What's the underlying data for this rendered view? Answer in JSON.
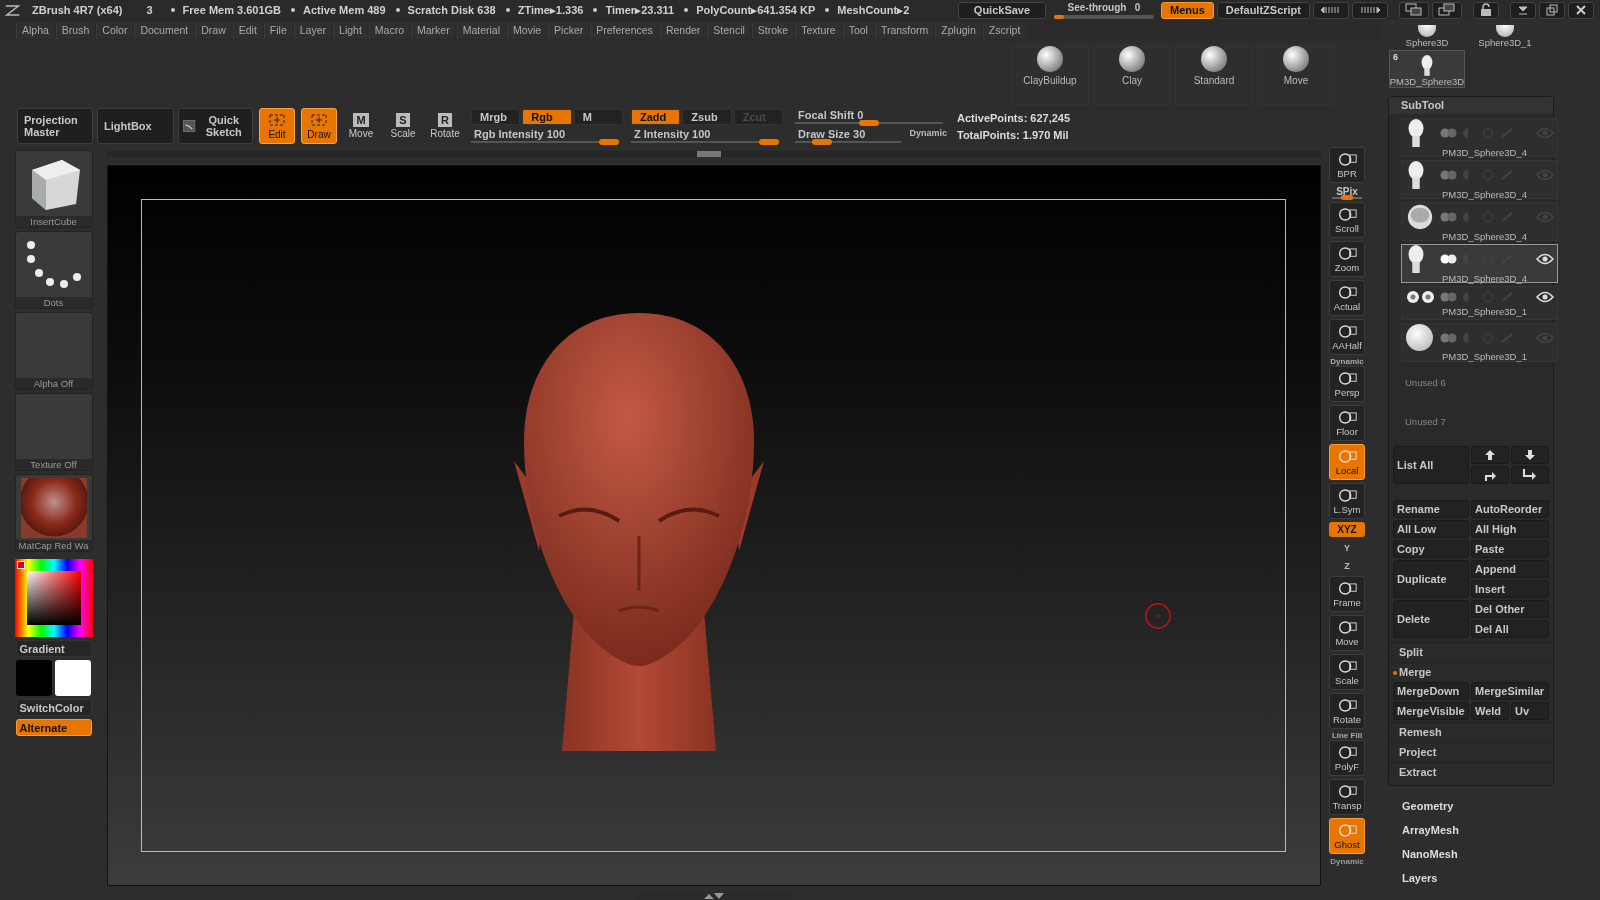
{
  "title_bar": {
    "app": "ZBrush 4R7 (x64)",
    "number": "3",
    "stats": [
      "Free Mem 3.601GB",
      "Active Mem 489",
      "Scratch Disk 638",
      "ZTime▸1.336",
      "Timer▸23.311",
      "PolyCount▸641.354 KP",
      "MeshCount▸2"
    ],
    "quicksave": "QuickSave",
    "see_through": {
      "label": "See-through",
      "value": "0",
      "level": 0.05
    },
    "menus": {
      "label": "Menus",
      "selected": true
    },
    "script": "DefaultZScript"
  },
  "menu": [
    "Alpha",
    "Brush",
    "Color",
    "Document",
    "Draw",
    "Edit",
    "File",
    "Layer",
    "Light",
    "Macro",
    "Marker",
    "Material",
    "Movie",
    "Picker",
    "Preferences",
    "Render",
    "Stencil",
    "Stroke",
    "Texture",
    "Tool",
    "Transform",
    "Zplugin",
    "Zscript"
  ],
  "shelf": {
    "brushes": [
      "ClayBuildup",
      "Clay",
      "Standard",
      "Move"
    ]
  },
  "toolbar": {
    "projection_master": "Projection Master",
    "lightbox": "LightBox",
    "quick_sketch": "Quick Sketch",
    "modes": [
      {
        "label": "Edit",
        "selected": true
      },
      {
        "label": "Draw",
        "selected": true
      },
      {
        "label": "Move",
        "glyph": "M",
        "selected": false
      },
      {
        "label": "Scale",
        "glyph": "S",
        "selected": false
      },
      {
        "label": "Rotate",
        "glyph": "R",
        "selected": false
      }
    ],
    "channels": [
      {
        "label": "Mrgb",
        "selected": false,
        "disabled": false
      },
      {
        "label": "Rgb",
        "selected": true,
        "disabled": false
      },
      {
        "label": "M",
        "selected": false,
        "disabled": false
      }
    ],
    "depth": [
      {
        "label": "Zadd",
        "selected": true,
        "disabled": false
      },
      {
        "label": "Zsub",
        "selected": false,
        "disabled": false
      },
      {
        "label": "Zcut",
        "selected": false,
        "disabled": true
      }
    ],
    "rgb_intensity": {
      "label": "Rgb  Intensity",
      "value": "100",
      "level": 1
    },
    "z_intensity": {
      "label": "Z  Intensity",
      "value": "100",
      "level": 1
    },
    "focal_shift": {
      "label": "Focal  Shift",
      "value": "0",
      "level": 0.5
    },
    "draw_size": {
      "label": "Draw  Size",
      "value": "30",
      "level": 0.2,
      "dynamic": "Dynamic"
    },
    "points": [
      "ActivePoints: 627,245",
      "TotalPoints: 1.970  Mil"
    ]
  },
  "left_panel": {
    "thumbnails": [
      {
        "label": "InsertCube",
        "kind": "cube"
      },
      {
        "label": "Dots",
        "kind": "dots"
      },
      {
        "label": "Alpha  Off",
        "kind": "empty"
      },
      {
        "label": "Texture  Off",
        "kind": "empty"
      },
      {
        "label": "MatCap  Red  Wa",
        "kind": "sphere"
      }
    ],
    "gradient": "Gradient",
    "switch_color": "SwitchColor",
    "alternate": {
      "label": "Alternate",
      "on": true
    }
  },
  "right_tools": [
    {
      "label": "BPR",
      "kind": "tall",
      "on": false
    },
    {
      "label": "SPix",
      "kind": "slider",
      "level": 0.5
    },
    {
      "label": "Scroll",
      "kind": "tall",
      "on": false
    },
    {
      "label": "Zoom",
      "kind": "tall",
      "on": false
    },
    {
      "label": "Actual",
      "kind": "tall",
      "on": false
    },
    {
      "label": "AAHalf",
      "kind": "tall",
      "on": false
    },
    {
      "label": "Persp",
      "kind": "tall",
      "on": false,
      "caption": "Dynamic"
    },
    {
      "label": "Floor",
      "kind": "tall",
      "on": false
    },
    {
      "label": "Local",
      "kind": "tall",
      "on": true
    },
    {
      "label": "L.Sym",
      "kind": "tall",
      "on": false
    },
    {
      "label": "XYZ",
      "kind": "pill",
      "on": true
    },
    {
      "label": "Y",
      "kind": "rot"
    },
    {
      "label": "Z",
      "kind": "rot"
    },
    {
      "label": "Frame",
      "kind": "tall",
      "on": false
    },
    {
      "label": "Move",
      "kind": "tall",
      "on": false
    },
    {
      "label": "Scale",
      "kind": "tall",
      "on": false
    },
    {
      "label": "Rotate",
      "kind": "tall",
      "on": false
    },
    {
      "label": "PolyF",
      "kind": "tall",
      "on": false,
      "caption": "Line Fill"
    },
    {
      "label": "Transp",
      "kind": "tall",
      "on": false
    },
    {
      "label": "Ghost",
      "kind": "tall",
      "on": true
    },
    {
      "label": "Dynamic",
      "kind": "partial"
    }
  ],
  "right_panel": {
    "tools": [
      {
        "label": "Sphere3D",
        "kind": "sphere"
      },
      {
        "label": "Sphere3D_1",
        "kind": "sphere"
      },
      {
        "label": "PM3D_Sphere3D",
        "kind": "bust",
        "badge": "6"
      }
    ],
    "subtool": {
      "title": "SubTool",
      "items": [
        {
          "name": "PM3D_Sphere3D_4",
          "kind": "bust",
          "selected": false,
          "visible": false
        },
        {
          "name": "PM3D_Sphere3D_4",
          "kind": "bust",
          "selected": false,
          "visible": false
        },
        {
          "name": "PM3D_Sphere3D_4",
          "kind": "bowl",
          "selected": false,
          "visible": false
        },
        {
          "name": "PM3D_Sphere3D_4",
          "kind": "bust",
          "selected": true,
          "visible": true
        },
        {
          "name": "PM3D_Sphere3D_1",
          "kind": "eyes",
          "selected": false,
          "visible": true
        },
        {
          "name": "PM3D_Sphere3D_1",
          "kind": "sphere",
          "selected": false,
          "visible": false
        }
      ],
      "unused": [
        "Unused  6",
        "Unused  7"
      ],
      "list_all": "List  All",
      "button_columns": [
        [
          {
            "label": "Rename",
            "kind": "short"
          },
          {
            "label": "All  Low",
            "kind": "short"
          },
          {
            "label": "Copy",
            "kind": "short"
          },
          {
            "label": "Duplicate",
            "kind": "tall"
          },
          {
            "label": "Delete",
            "kind": "tall"
          }
        ],
        [
          {
            "label": "AutoReorder",
            "kind": "short"
          },
          {
            "label": "All  High",
            "kind": "short"
          },
          {
            "label": "Paste",
            "kind": "short"
          },
          {
            "label": "Append",
            "kind": "short"
          },
          {
            "label": "Insert",
            "kind": "short"
          },
          {
            "label": "Del  Other",
            "kind": "short"
          },
          {
            "label": "Del  All",
            "kind": "short"
          }
        ]
      ],
      "sections": [
        {
          "label": "Split",
          "expanded": false
        },
        {
          "label": "Merge",
          "expanded": true,
          "buttons": [
            {
              "label": "MergeDown",
              "kind": "normal"
            },
            {
              "label": "MergeSimilar",
              "kind": "wide"
            },
            {
              "label": "MergeVisible",
              "kind": "normal"
            },
            {
              "label": "Weld",
              "kind": "small"
            },
            {
              "label": "Uv",
              "kind": "small"
            }
          ]
        },
        {
          "label": "Remesh",
          "expanded": false
        },
        {
          "label": "Project",
          "expanded": false
        },
        {
          "label": "Extract",
          "expanded": false
        }
      ]
    },
    "palettes": [
      "Geometry",
      "ArrayMesh",
      "NanoMesh",
      "Layers"
    ]
  }
}
